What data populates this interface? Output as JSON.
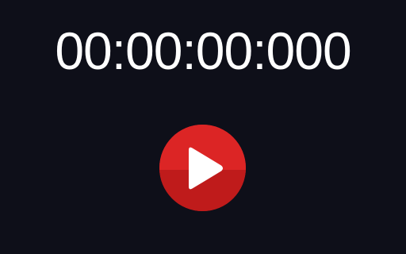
{
  "timer": {
    "display": "00:00:00:000"
  },
  "controls": {
    "play_icon": "play-icon"
  },
  "colors": {
    "background": "#0e0f19",
    "text": "#ffffff",
    "button_red": "#dc2525",
    "button_red_dark": "#bf1b1b",
    "icon": "#ffffff"
  }
}
